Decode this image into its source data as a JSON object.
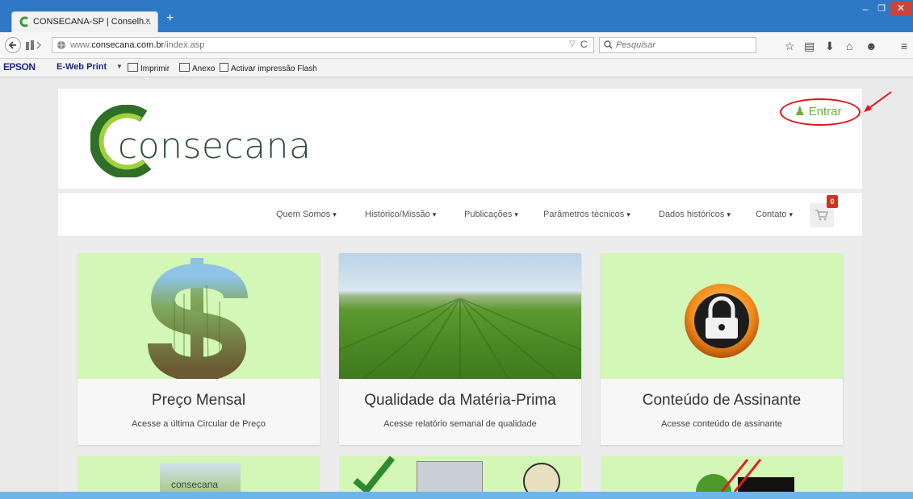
{
  "browser": {
    "tab_title": "CONSECANA-SP | Conselh...",
    "tab_close": "×",
    "new_tab": "+",
    "window_min": "–",
    "window_restore": "❐",
    "window_close": "✕",
    "url_prefix": "www.",
    "url_domain": "consecana.com.br",
    "url_path": "/index.asp",
    "search_placeholder": "Pesquisar"
  },
  "epson": {
    "brand": "EPSON",
    "ewebprint": "E-Web Print",
    "print": "Imprimir",
    "attach": "Anexo",
    "flash": "Activar impressão Flash"
  },
  "site": {
    "logo_text": "consecana",
    "login": "Entrar",
    "cart_count": "0",
    "menu": [
      "Quem Somos",
      "Histórico/Missão",
      "Publicações",
      "Parâmetros técnicos",
      "Dados históricos",
      "Contato"
    ],
    "cards": [
      {
        "title": "Preço Mensal",
        "subtitle": "Acesse a última Circular de Preço"
      },
      {
        "title": "Qualidade da Matéria-Prima",
        "subtitle": "Acesse relatório semanal de qualidade"
      },
      {
        "title": "Conteúdo de Assinante",
        "subtitle": "Acesse conteúdo de assinante"
      }
    ],
    "small_logo_text": "consecana"
  },
  "colors": {
    "titlebar": "#2e78c5",
    "accent_green": "#6cae3a",
    "card_green": "#d3f7b6",
    "annotation_red": "#e1141a",
    "badge_red": "#d0321f"
  }
}
